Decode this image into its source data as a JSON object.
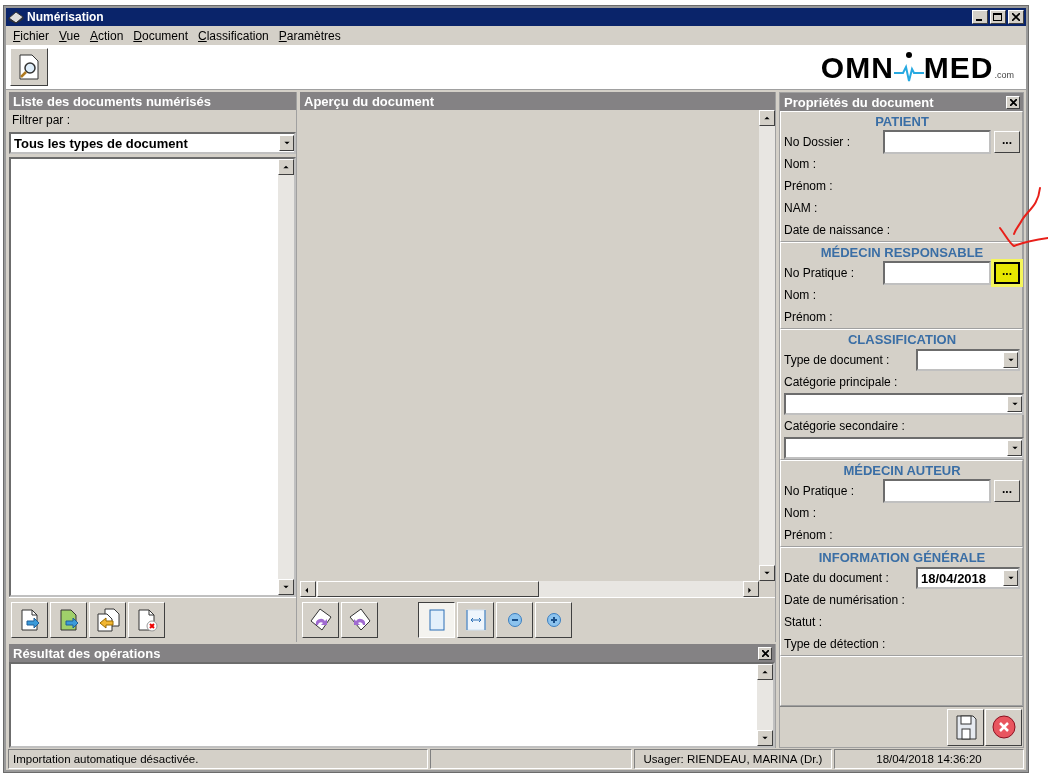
{
  "window": {
    "title": "Numérisation"
  },
  "menu": [
    "Fichier",
    "Vue",
    "Action",
    "Document",
    "Classification",
    "Paramètres"
  ],
  "logo": {
    "left": "OMN",
    "right": "MED",
    "suffix": ".com"
  },
  "documents_panel": {
    "title": "Liste des documents numérisés",
    "filter_label": "Filtrer par :",
    "filter_value": "Tous les types de document",
    "tools": [
      {
        "kind": "import"
      },
      {
        "kind": "import-green"
      },
      {
        "kind": "export"
      },
      {
        "kind": "delete"
      }
    ]
  },
  "preview_panel": {
    "title": "Aperçu du document",
    "rotate_tools": [
      {
        "kind": "rotate-right"
      },
      {
        "kind": "rotate-left"
      }
    ],
    "view_tools": [
      {
        "kind": "fit-page",
        "selected": true
      },
      {
        "kind": "fit-width",
        "selected": false
      },
      {
        "kind": "zoom-out",
        "selected": false
      },
      {
        "kind": "zoom-in",
        "selected": false
      }
    ]
  },
  "results_panel": {
    "title": "Résultat des opérations"
  },
  "properties_panel": {
    "title": "Propriétés du document",
    "sections": [
      {
        "title": "PATIENT",
        "fields": [
          {
            "kind": "lookup",
            "label": "No Dossier :",
            "button": "...",
            "highlighted": false
          },
          {
            "kind": "label",
            "label": "Nom :"
          },
          {
            "kind": "label",
            "label": "Prénom :"
          },
          {
            "kind": "label",
            "label": "NAM :"
          },
          {
            "kind": "label",
            "label": "Date de naissance :"
          }
        ]
      },
      {
        "title": "MÉDECIN RESPONSABLE",
        "fields": [
          {
            "kind": "lookup",
            "label": "No Pratique :",
            "button": "...",
            "highlighted": true
          },
          {
            "kind": "label",
            "label": "Nom :"
          },
          {
            "kind": "label",
            "label": "Prénom :"
          }
        ]
      },
      {
        "title": "CLASSIFICATION",
        "fields": [
          {
            "kind": "select",
            "label": "Type de document :"
          },
          {
            "kind": "select-below",
            "label": "Catégorie principale :"
          },
          {
            "kind": "select-below",
            "label": "Catégorie secondaire :"
          }
        ]
      },
      {
        "title": "MÉDECIN AUTEUR",
        "fields": [
          {
            "kind": "lookup",
            "label": "No Pratique :",
            "button": "...",
            "highlighted": false
          },
          {
            "kind": "label",
            "label": "Nom :"
          },
          {
            "kind": "label",
            "label": "Prénom :"
          }
        ]
      },
      {
        "title": "INFORMATION GÉNÉRALE",
        "fields": [
          {
            "kind": "select",
            "label": "Date du document :",
            "value": "18/04/2018"
          },
          {
            "kind": "label",
            "label": "Date de numérisation :"
          },
          {
            "kind": "label",
            "label": "Statut :"
          },
          {
            "kind": "label",
            "label": "Type de détection :"
          }
        ]
      }
    ]
  },
  "status_bar": [
    {
      "text": "Importation automatique désactivée."
    },
    {
      "text": "Usager: RIENDEAU, MARINA (Dr.)"
    },
    {
      "text": "18/04/2018 14:36:20"
    }
  ]
}
